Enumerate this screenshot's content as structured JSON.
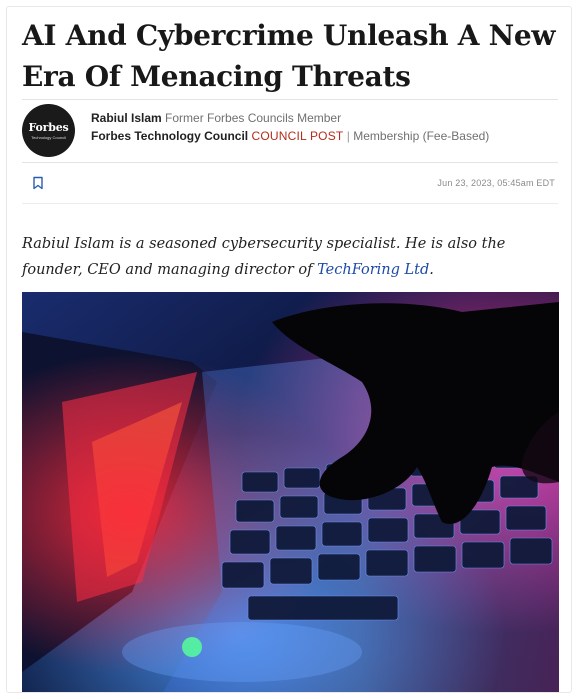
{
  "article": {
    "headline": "AI And Cybercrime Unleash A New Era Of Menacing Threats",
    "logo": {
      "brand": "Forbes",
      "sub": "Technology Council"
    },
    "author": {
      "name": "Rabiul Islam",
      "role": "Former Forbes Councils Member"
    },
    "council": {
      "name": "Forbes Technology Council",
      "post_label": "COUNCIL POST",
      "separator": "|",
      "membership": "Membership (Fee-Based)"
    },
    "date": "Jun 23, 2023, 05:45am EDT",
    "bio": {
      "text": "Rabiul Islam is a seasoned cybersecurity specialist. He is also the founder, CEO and managing director of ",
      "link_text": "TechForing Ltd",
      "suffix": "."
    }
  },
  "icons": {
    "bookmark": "bookmark-icon"
  },
  "colors": {
    "post_label": "#b52b1c",
    "link": "#1d4aa8",
    "headline": "#181818"
  }
}
